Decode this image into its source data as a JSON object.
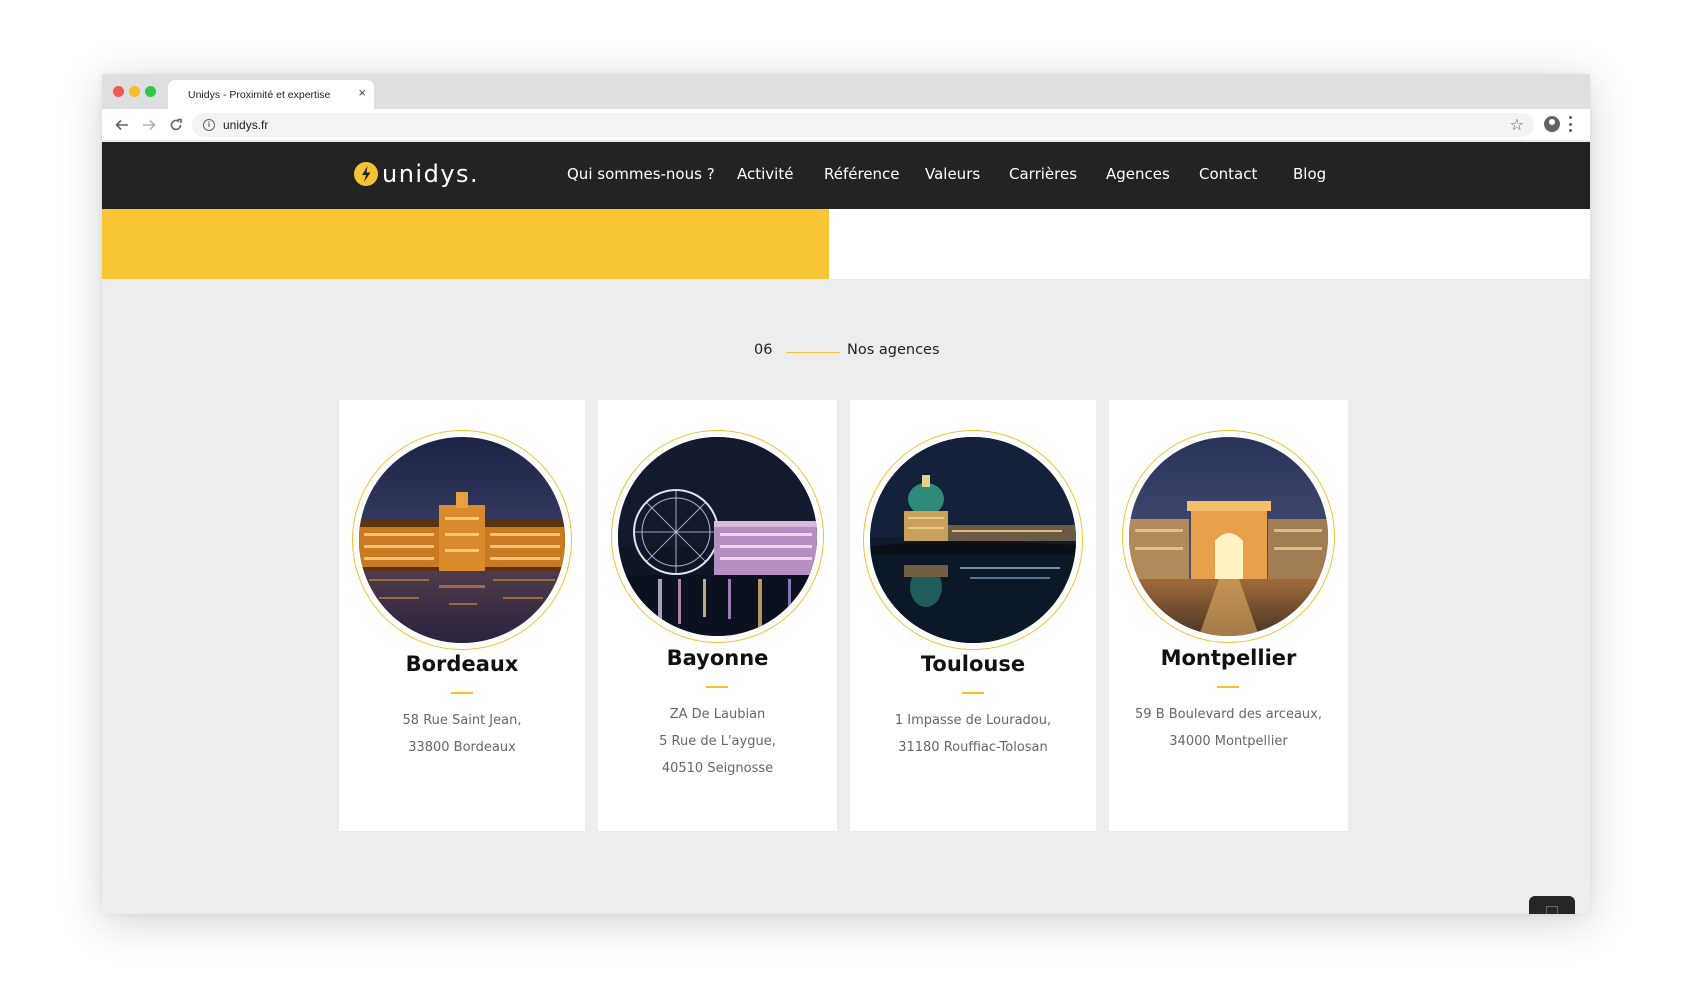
{
  "browser": {
    "tab_title": "Unidys - Proximité et expertise",
    "tab_close": "×",
    "url": "unidys.fr"
  },
  "header": {
    "logo_text": "unidys.",
    "nav": [
      {
        "label": "Qui sommes-nous ?"
      },
      {
        "label": "Activité"
      },
      {
        "label": "Référence"
      },
      {
        "label": "Valeurs"
      },
      {
        "label": "Carrières"
      },
      {
        "label": "Agences"
      },
      {
        "label": "Contact"
      },
      {
        "label": "Blog"
      }
    ]
  },
  "section": {
    "number": "06",
    "title": "Nos agences"
  },
  "agencies": [
    {
      "city": "Bordeaux",
      "address": [
        "58 Rue Saint Jean,",
        "33800 Bordeaux"
      ],
      "photo": "bordeaux-night-photo"
    },
    {
      "city": "Bayonne",
      "address": [
        "ZA De Laubian",
        "5 Rue de L'aygue,",
        "40510 Seignosse"
      ],
      "photo": "ferris-wheel-night-photo"
    },
    {
      "city": "Toulouse",
      "address": [
        "1 Impasse de Louradou,",
        "31180 Rouffiac-Tolosan"
      ],
      "photo": "toulouse-dome-night-photo"
    },
    {
      "city": "Montpellier",
      "address": [
        "59 B Boulevard des arceaux,",
        "34000 Montpellier"
      ],
      "photo": "arc-de-triomphe-montpellier-photo"
    }
  ],
  "colors": {
    "accent": "#f8c535",
    "header_bg": "#232323",
    "section_bg": "#ededed"
  }
}
